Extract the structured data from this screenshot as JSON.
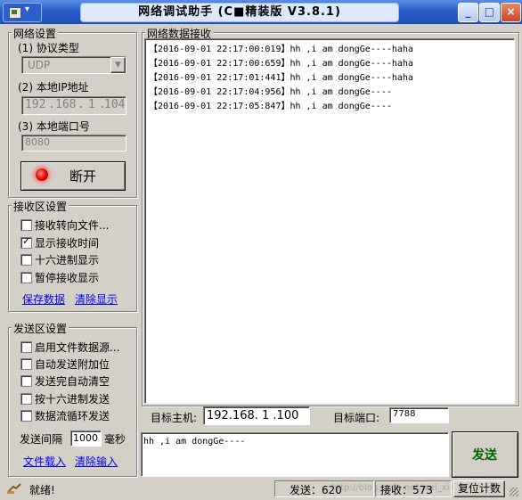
{
  "window": {
    "title": "网络调试助手 (C■精装版 V3.8.1)",
    "sys_arrow": "▾",
    "min_glyph": "_",
    "max_glyph": "□",
    "close_glyph": "×"
  },
  "net_settings": {
    "title": "网络设置",
    "protocol_label": "(1) 协议类型",
    "protocol_value": "UDP",
    "ip_label": "(2) 本地IP地址",
    "ip_parts": [
      "192",
      "168",
      "1",
      "104"
    ],
    "ip_sep": ".",
    "port_label": "(3) 本地端口号",
    "port_value": "8080",
    "connect_button": "断开"
  },
  "recv_settings": {
    "title": "接收区设置",
    "options": [
      {
        "label": "接收转向文件...",
        "checked": false
      },
      {
        "label": "显示接收时间",
        "checked": true
      },
      {
        "label": "十六进制显示",
        "checked": false
      },
      {
        "label": "暂停接收显示",
        "checked": false
      }
    ],
    "save_link": "保存数据",
    "clear_link": "清除显示"
  },
  "send_settings": {
    "title": "发送区设置",
    "options": [
      {
        "label": "启用文件数据源...",
        "checked": false
      },
      {
        "label": "自动发送附加位",
        "checked": false
      },
      {
        "label": "发送完自动清空",
        "checked": false
      },
      {
        "label": "按十六进制发送",
        "checked": false
      },
      {
        "label": "数据流循环发送",
        "checked": false
      }
    ],
    "interval_label": "发送间隔",
    "interval_value": "1000",
    "interval_unit": "毫秒",
    "load_link": "文件载入",
    "clear_link": "清除输入"
  },
  "receive_area": {
    "title": "网络数据接收",
    "lines": [
      "【2016-09-01 22:17:00:019】hh ,i am dongGe----haha",
      "【2016-09-01 22:17:00:659】hh ,i am dongGe----haha",
      "【2016-09-01 22:17:01:441】hh ,i am dongGe----haha",
      "【2016-09-01 22:17:04:956】hh ,i am dongGe----",
      "【2016-09-01 22:17:05:847】hh ,i am dongGe----"
    ]
  },
  "target": {
    "host_label": "目标主机:",
    "host_value": "192.168. 1 .100",
    "port_label": "目标端口:",
    "port_value": "7788"
  },
  "send_area": {
    "text": "hh ,i am dongGe----",
    "send_button": "发送"
  },
  "status": {
    "text": "就绪!",
    "sent": "发送：620",
    "received": "接收：573",
    "reset_button": "复位计数",
    "watermark": "http://blog.csdn.net/wei_xiaoxiao"
  },
  "colors": {
    "titlebar": "#2a5ec8",
    "face": "#d4d0c8",
    "link": "#0000ff",
    "send_button_text": "#006400",
    "led": "#e00000"
  }
}
